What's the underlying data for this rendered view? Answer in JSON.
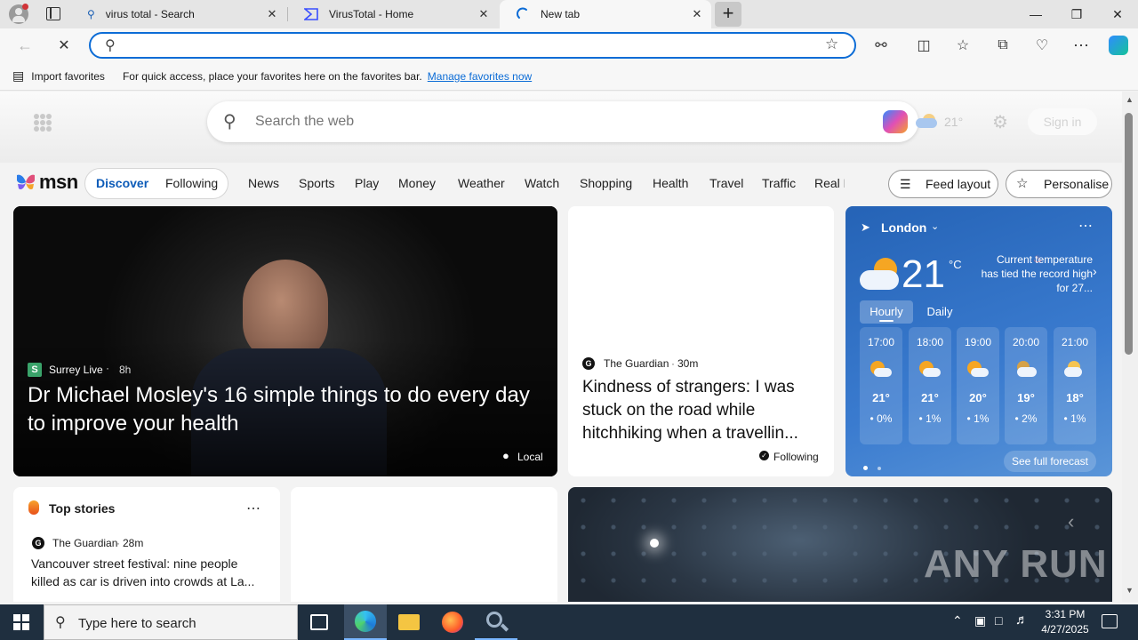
{
  "tabs": [
    {
      "title": "virus total - Search",
      "icon": "search-favicon"
    },
    {
      "title": "VirusTotal - Home",
      "icon": "virustotal-favicon"
    },
    {
      "title": "New tab",
      "icon": "loading-favicon"
    }
  ],
  "favorites_bar": {
    "import_label": "Import favorites",
    "hint": "For quick access, place your favorites here on the favorites bar.",
    "manage_link": "Manage favorites now"
  },
  "msn": {
    "search_placeholder": "Search the web",
    "weather_temp_top": "21°",
    "signin_label": "Sign in",
    "logo_text": "msn",
    "feed_tabs": [
      "Discover",
      "Following"
    ],
    "nav": [
      "News",
      "Sports",
      "Play",
      "Money",
      "Weather",
      "Watch",
      "Shopping",
      "Health",
      "Travel",
      "Traffic",
      "Real E"
    ],
    "feed_layout_label": "Feed layout",
    "personalise_label": "Personalise"
  },
  "hero": {
    "source": "Surrey Live",
    "age": "8h",
    "headline": "Dr Michael Mosley's 16 simple things to do every day to improve your health",
    "location_tag": "Local"
  },
  "story2": {
    "source": "The Guardian",
    "age": "30m",
    "headline": "Kindness of strangers: I was stuck on the road while hitchhiking when a travellin...",
    "following_label": "Following"
  },
  "weather": {
    "city": "London",
    "temp": "21",
    "unit": "°C",
    "note": "Current temperature has tied the record high for 27...",
    "tabs": [
      "Hourly",
      "Daily"
    ],
    "hours": [
      {
        "time": "17:00",
        "temp": "21°",
        "precip": "0%"
      },
      {
        "time": "18:00",
        "temp": "21°",
        "precip": "1%"
      },
      {
        "time": "19:00",
        "temp": "20°",
        "precip": "1%"
      },
      {
        "time": "20:00",
        "temp": "19°",
        "precip": "2%"
      },
      {
        "time": "21:00",
        "temp": "18°",
        "precip": "1%"
      }
    ],
    "full_forecast": "See full forecast"
  },
  "top_stories": {
    "title": "Top stories",
    "source": "The Guardian",
    "age": "28m",
    "headline": "Vancouver street festival: nine people killed as car is driven into crowds at La..."
  },
  "watermark": "ANY RUN",
  "taskbar": {
    "search_placeholder": "Type here to search",
    "time": "3:31 PM",
    "date": "4/27/2025"
  },
  "colors": {
    "accent": "#0c6cd6",
    "weather_bg": "#2f6fbf",
    "taskbar": "#1f2f3f"
  }
}
